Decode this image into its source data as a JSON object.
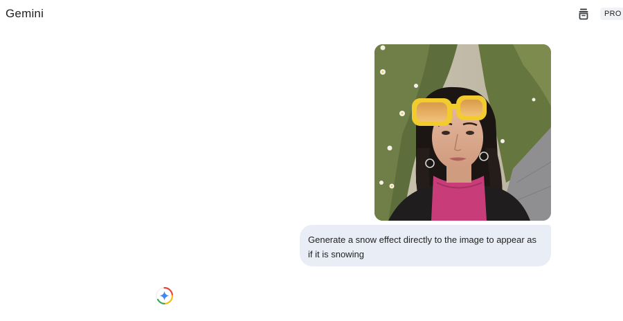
{
  "header": {
    "app_title": "Gemini",
    "temp_chat_icon": "temporary-chat-icon",
    "pro_badge": "PRO"
  },
  "conversation": {
    "user_image_alt": "selfie-photo",
    "user_prompt": "Generate a snow effect directly to the image to appear as if it is snowing"
  },
  "response": {
    "loading_icon": "gemini-spark-icon"
  },
  "colors": {
    "bubble_bg": "#e9eef6",
    "badge_bg": "#f0f2f5",
    "text": "#1f1f1f",
    "spark_blue": "#4285f4"
  }
}
